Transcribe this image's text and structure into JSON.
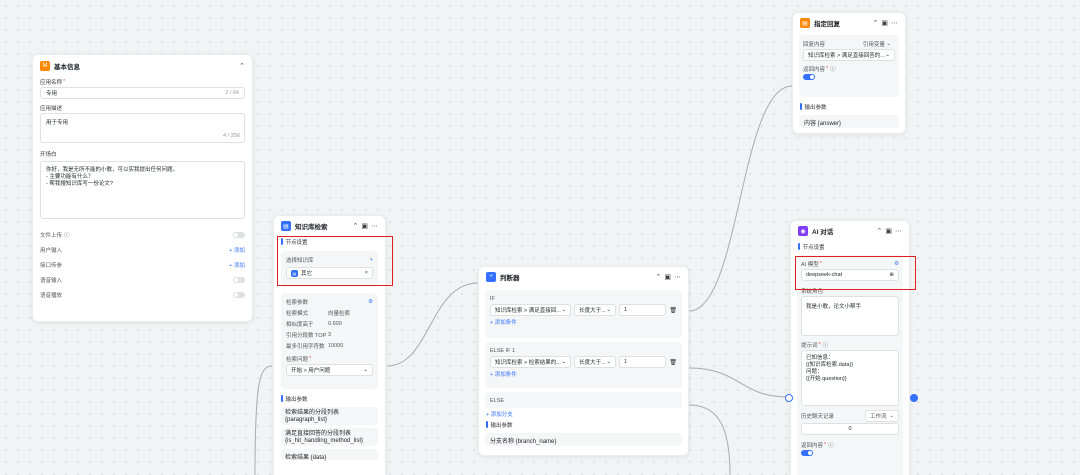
{
  "basic": {
    "title": "基本信息",
    "app_name_label": "应用名称",
    "app_name_value": "专用",
    "app_name_count": "2 / 64",
    "desc_label": "应用描述",
    "desc_value": "用于专用",
    "desc_count": "4 / 256",
    "opening_label": "开场白",
    "opening_lines": [
      "你好，我是无所不能的小歌，可以实我提出任何问题。",
      "- 主要功能有什么？",
      "- 帮我搜知识库写一份论文?"
    ],
    "file_upload": "文件上传",
    "user_input": "用户输入",
    "api_attach": "接口传参",
    "voice_input": "语音输入",
    "voice_play": "语音播放",
    "add": "+ 添加"
  },
  "kb": {
    "title": "知识库检索",
    "node_settings": "节点设置",
    "select_kb": "选择知识库",
    "plus": "+",
    "kb_item": "其它",
    "kb_item_close": "×",
    "search_params": "检索参数",
    "mode_label": "检索模式",
    "mode_value": "向量检索",
    "sim_label": "相似度高于",
    "sim_value": "0.600",
    "topn_label": "引用分段数 TOP",
    "topn_value": "3",
    "maxchar_label": "最多引用字符数",
    "maxchar_value": "10000",
    "question_label": "检索问题",
    "question_value": "开始 > 用户问题",
    "output_label": "输出参数",
    "outputs": [
      "检索结果的分段列表 {paragraph_list}",
      "满足直接回答的分段列表 {is_hit_handling_method_list}",
      "检索结果 {data}"
    ]
  },
  "judge": {
    "title": "判断器",
    "if_label": "IF",
    "if_field": "知识库检索 > 满足直接回...",
    "if_op": "长度大于...",
    "if_val": "1",
    "add_cond": "+ 添加条件",
    "elseif_label": "ELSE IF 1",
    "elseif_field": "知识库检索 > 检索结果的...",
    "elseif_op": "长度大于...",
    "elseif_val": "1",
    "add_cond2": "+ 添加条件",
    "else_label": "ELSE",
    "add_branch": "+ 添加分支",
    "output_label": "输出参数",
    "output_value": "分支名称 {branch_name}"
  },
  "reply": {
    "title": "指定回复",
    "content_label": "回复内容",
    "content_mode": "引用变量",
    "content_value": "知识库检索 > 满足直接回答的...",
    "return_label": "返回内容",
    "output_label": "输出参数",
    "output_value": "内容 {answer}"
  },
  "ai": {
    "title": "AI 对话",
    "node_settings": "节点设置",
    "model_label": "AI 模型",
    "model_value": "deepseek-chat",
    "role_label": "系统角色",
    "role_value": "我是小歌，论文小帮手",
    "prompt_label": "提示词",
    "prompt_lines": [
      "已知信息：",
      "{{知识库检索.data}}",
      "问题：",
      "{{开始.question}}"
    ],
    "history_label": "历史聊天记录",
    "history_mode": "工作流",
    "history_value": "0",
    "return_label": "返回内容"
  },
  "colors": {
    "accent": "#3370ff",
    "highlight": "#e02020"
  }
}
